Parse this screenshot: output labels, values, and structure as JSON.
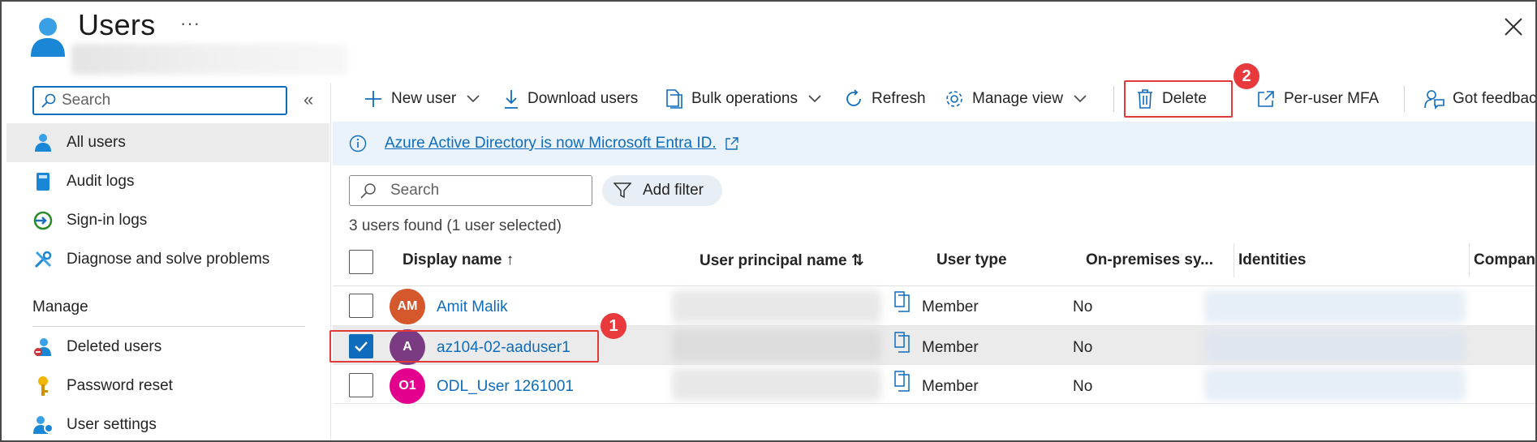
{
  "header": {
    "title": "Users",
    "more": "···"
  },
  "colors": {
    "accent": "#0f6cbd",
    "highlight_red": "#e23a3a",
    "banner_bg": "#eaf3fb",
    "selected_row": "#ebebeb"
  },
  "sidebar": {
    "search_placeholder": "Search",
    "collapse": "«",
    "items": [
      {
        "label": "All users",
        "icon": "user-icon",
        "active": true
      },
      {
        "label": "Audit logs",
        "icon": "book-icon"
      },
      {
        "label": "Sign-in logs",
        "icon": "sign-in-icon"
      },
      {
        "label": "Diagnose and solve problems",
        "icon": "wrench-icon"
      }
    ],
    "section_label": "Manage",
    "manage_items": [
      {
        "label": "Deleted users",
        "icon": "deleted-user-icon"
      },
      {
        "label": "Password reset",
        "icon": "key-icon"
      },
      {
        "label": "User settings",
        "icon": "user-settings-icon"
      }
    ]
  },
  "toolbar": {
    "new_user": "New user",
    "download": "Download users",
    "bulk": "Bulk operations",
    "refresh": "Refresh",
    "manage_view": "Manage view",
    "delete": "Delete",
    "per_user_mfa": "Per-user MFA",
    "feedback": "Got feedback?"
  },
  "callouts": {
    "one": "1",
    "two": "2"
  },
  "banner": {
    "text": "Azure Active Directory is now Microsoft Entra ID."
  },
  "filters": {
    "search_placeholder": "Search",
    "add_filter": "Add filter",
    "count": "3 users found (1 user selected)"
  },
  "table": {
    "columns": [
      "Display name ↑",
      "User principal name ⇅",
      "User type",
      "On-premises sy...",
      "Identities",
      "Company name"
    ],
    "rows": [
      {
        "initials": "AM",
        "avatar_color": "#d4582c",
        "name": "Amit Malik",
        "type": "Member",
        "onprem": "No",
        "selected": false
      },
      {
        "initials": "A",
        "avatar_color": "#7b3b82",
        "name": "az104-02-aaduser1",
        "type": "Member",
        "onprem": "No",
        "selected": true
      },
      {
        "initials": "O1",
        "avatar_color": "#e3008c",
        "name": "ODL_User 1261001",
        "type": "Member",
        "onprem": "No",
        "selected": false
      }
    ]
  }
}
